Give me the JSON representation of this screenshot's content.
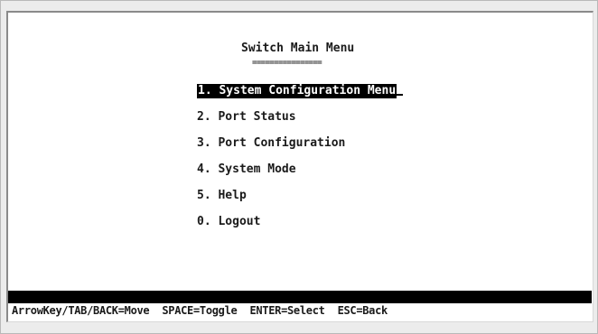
{
  "title": "Switch Main Menu",
  "title_underline": "================",
  "menu": [
    {
      "number": "1",
      "label": "System Configuration Menu",
      "selected": true
    },
    {
      "number": "2",
      "label": "Port Status",
      "selected": false
    },
    {
      "number": "3",
      "label": "Port Configuration",
      "selected": false
    },
    {
      "number": "4",
      "label": "System Mode",
      "selected": false
    },
    {
      "number": "5",
      "label": "Help",
      "selected": false
    },
    {
      "number": "0",
      "label": "Logout",
      "selected": false
    }
  ],
  "status_bar": {
    "move": "ArrowKey/TAB/BACK=Move",
    "toggle": "SPACE=Toggle",
    "select": "ENTER=Select",
    "back": "ESC=Back"
  },
  "colors": {
    "highlight_bg": "#000000",
    "highlight_fg": "#ffffff",
    "text": "#1a1a1a",
    "screen_bg": "#ffffff"
  }
}
